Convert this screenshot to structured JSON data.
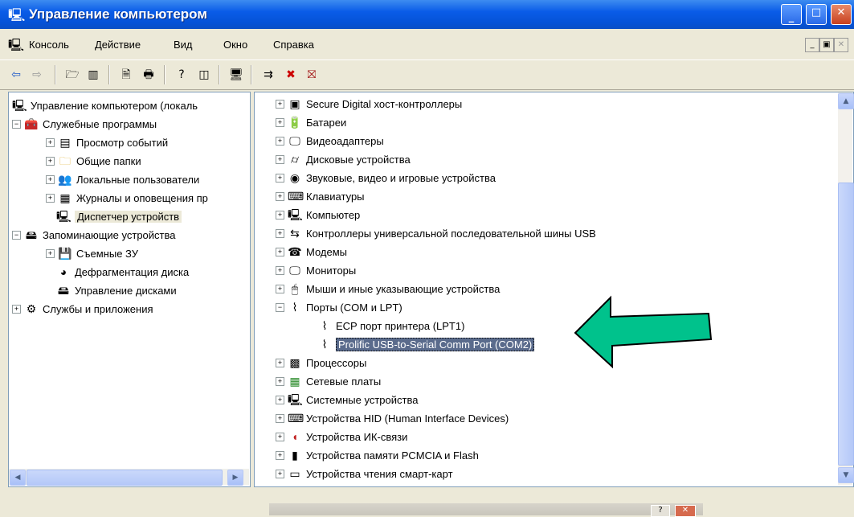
{
  "window": {
    "title": "Управление компьютером"
  },
  "menu": {
    "items": [
      "Консоль",
      "Действие",
      "Вид",
      "Окно",
      "Справка"
    ]
  },
  "tree": {
    "items": [
      {
        "label": "Управление компьютером (локаль",
        "icon": "computer-icon",
        "level": 0
      },
      {
        "label": "Служебные программы",
        "icon": "tools-icon",
        "level": 1,
        "expander": "−"
      },
      {
        "label": "Просмотр событий",
        "icon": "event-viewer-icon",
        "level": 2,
        "expander": "+"
      },
      {
        "label": "Общие папки",
        "icon": "folder-icon",
        "level": 2,
        "expander": "+"
      },
      {
        "label": "Локальные пользователи",
        "icon": "users-icon",
        "level": 2,
        "expander": "+"
      },
      {
        "label": "Журналы и оповещения пр",
        "icon": "logs-icon",
        "level": 2,
        "expander": "+"
      },
      {
        "label": "Диспетчер устройств",
        "icon": "device-manager-icon",
        "level": 2,
        "selected": true
      },
      {
        "label": "Запоминающие устройства",
        "icon": "storage-icon",
        "level": 1,
        "expander": "−"
      },
      {
        "label": "Съемные ЗУ",
        "icon": "removable-storage-icon",
        "level": 2,
        "expander": "+"
      },
      {
        "label": "Дефрагментация диска",
        "icon": "defrag-icon",
        "level": 2
      },
      {
        "label": "Управление дисками",
        "icon": "disk-management-icon",
        "level": 2
      },
      {
        "label": "Службы и приложения",
        "icon": "services-icon",
        "level": 1,
        "expander": "+"
      }
    ]
  },
  "devices": {
    "items": [
      {
        "label": "Secure Digital хост-контроллеры",
        "icon": "sd-host-icon",
        "expander": "+"
      },
      {
        "label": "Батареи",
        "icon": "battery-icon",
        "expander": "+"
      },
      {
        "label": "Видеоадаптеры",
        "icon": "display-adapter-icon",
        "expander": "+"
      },
      {
        "label": "Дисковые устройства",
        "icon": "disk-drive-icon",
        "expander": "+"
      },
      {
        "label": "Звуковые, видео и игровые устройства",
        "icon": "sound-icon",
        "expander": "+"
      },
      {
        "label": "Клавиатуры",
        "icon": "keyboard-icon",
        "expander": "+"
      },
      {
        "label": "Компьютер",
        "icon": "computer-icon",
        "expander": "+"
      },
      {
        "label": "Контроллеры универсальной последовательной шины USB",
        "icon": "usb-icon",
        "expander": "+"
      },
      {
        "label": "Модемы",
        "icon": "modem-icon",
        "expander": "+"
      },
      {
        "label": "Мониторы",
        "icon": "monitor-icon",
        "expander": "+"
      },
      {
        "label": "Мыши и иные указывающие устройства",
        "icon": "mouse-icon",
        "expander": "+"
      },
      {
        "label": "Порты (COM и LPT)",
        "icon": "port-icon",
        "expander": "−"
      },
      {
        "label": "ECP порт принтера (LPT1)",
        "icon": "port-icon",
        "child": true
      },
      {
        "label": "Prolific USB-to-Serial Comm Port (COM2)",
        "icon": "port-icon",
        "child": true,
        "selected": true
      },
      {
        "label": "Процессоры",
        "icon": "processor-icon",
        "expander": "+"
      },
      {
        "label": "Сетевые платы",
        "icon": "network-card-icon",
        "expander": "+"
      },
      {
        "label": "Системные устройства",
        "icon": "system-device-icon",
        "expander": "+"
      },
      {
        "label": "Устройства HID (Human Interface Devices)",
        "icon": "hid-icon",
        "expander": "+"
      },
      {
        "label": "Устройства ИК-связи",
        "icon": "infrared-icon",
        "expander": "+"
      },
      {
        "label": "Устройства памяти PCMCIA и Flash",
        "icon": "pcmcia-icon",
        "expander": "+"
      },
      {
        "label": "Устройства чтения смарт-карт",
        "icon": "smart-card-icon",
        "expander": "+"
      }
    ]
  },
  "colors": {
    "titlebar": "#0A5CE8",
    "arrow_fill": "#00C28C",
    "selection": "#5A6B8C"
  }
}
